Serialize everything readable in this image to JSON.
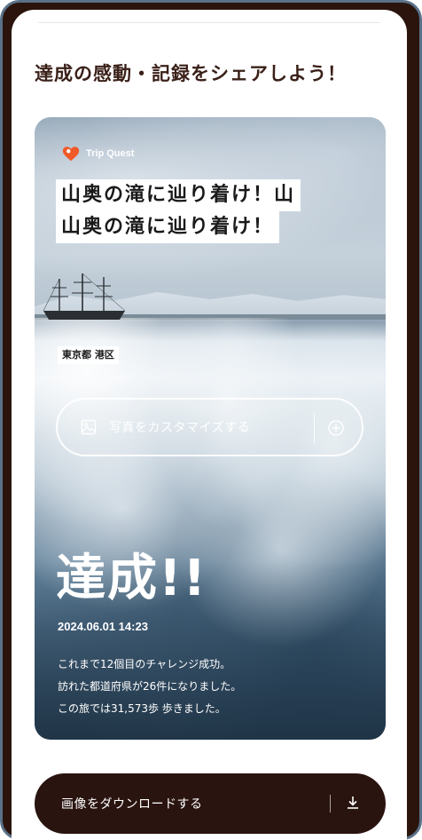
{
  "page": {
    "heading": "達成の感動・記録をシェアしよう！"
  },
  "card": {
    "brand_name": "Trip Quest",
    "title_lines": [
      "山奥の滝に辿り着け！山",
      "山奥の滝に辿り着け！"
    ],
    "location": "東京都 港区",
    "customize_label": "写真をカスタマイズする",
    "achieved": "達成!!",
    "datetime": "2024.06.01 14:23",
    "stats": [
      "これまで12個目のチャレンジ成功。",
      "訪れた都道府県が26件になりました。",
      "この旅では31,573歩 歩きました。"
    ]
  },
  "download": {
    "label": "画像をダウンロードする"
  },
  "icons": {
    "brand": "heart-pin-icon",
    "customize": "image-icon",
    "plus": "plus-circle-icon",
    "download": "download-icon"
  },
  "colors": {
    "brand_accent": "#f05a28",
    "heading_text": "#3a2018",
    "download_button_bg": "#2a1410",
    "frame_border": "#5a7188"
  }
}
